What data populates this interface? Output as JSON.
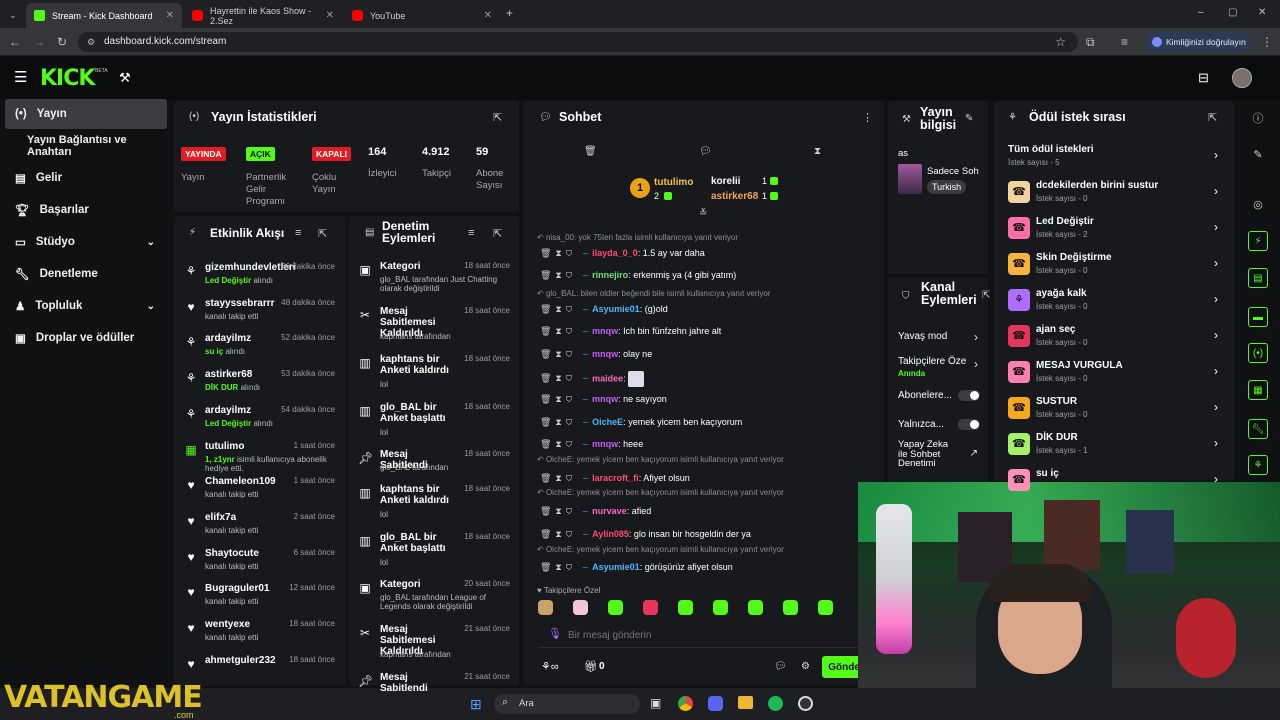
{
  "browser": {
    "tabs": [
      {
        "label": "Stream - Kick Dashboard",
        "active": true
      },
      {
        "label": "Hayrettin ile Kaos Show - 2.Sez",
        "active": false
      },
      {
        "label": "YouTube",
        "active": false
      }
    ],
    "url": "dashboard.kick.com/stream",
    "verify_label": "Kimliğinizi doğrulayın"
  },
  "kick": {
    "logo": "KICK",
    "beta": "BETA"
  },
  "sidebar": {
    "items": [
      {
        "label": "Yayın",
        "icon": "broadcast-icon"
      },
      {
        "label": "Yayın Bağlantısı ve Anahtarı"
      },
      {
        "label": "Gelir",
        "icon": "revenue-icon"
      },
      {
        "label": "Başarılar",
        "icon": "trophy-icon"
      },
      {
        "label": "Stüdyo",
        "icon": "studio-icon"
      },
      {
        "label": "Denetleme",
        "icon": "wrench-icon"
      },
      {
        "label": "Topluluk",
        "icon": "community-icon"
      },
      {
        "label": "Droplar ve ödüller",
        "icon": "gift-icon"
      }
    ]
  },
  "stats": {
    "title": "Yayın İstatistikleri",
    "live_badge": "YAYINDA",
    "live_label": "Yayın",
    "partner_badge": "AÇIK",
    "partner_label": "Partnerlik Gelir Programı",
    "multi_badge": "KAPALI",
    "multi_label": "Çoklu Yayın",
    "viewers": "164",
    "viewers_label": "İzleyici",
    "followers": "4.912",
    "followers_label": "Takipçi",
    "subs": "59",
    "subs_label": "Abone Sayısı"
  },
  "activity": {
    "title": "Etkinlik Akışı",
    "items": [
      {
        "name": "gizemhundevletleri",
        "time": "36 dakika önce",
        "sub": "Led Değiştir",
        "suffix": " alındı"
      },
      {
        "name": "stayyssebrarrr",
        "time": "48 dakika önce",
        "sub": "",
        "suffix": "kanalı takip etti"
      },
      {
        "name": "ardayilmz",
        "time": "52 dakika önce",
        "sub": "su iç",
        "suffix": " alındı"
      },
      {
        "name": "astirker68",
        "time": "53 dakika önce",
        "sub": "DİK DUR",
        "suffix": " alındı"
      },
      {
        "name": "ardayilmz",
        "time": "54 dakika önce",
        "sub": "Led Değiştir",
        "suffix": " alındı"
      },
      {
        "name": "tutulimo",
        "time": "1 saat önce",
        "sub": "1, z1ynr",
        "suffix": " isimli kullanıcıya abonelik hediye etti."
      },
      {
        "name": "Chameleon109",
        "time": "1 saat önce",
        "sub": "",
        "suffix": "kanalı takip etti"
      },
      {
        "name": "elifx7a",
        "time": "2 saat önce",
        "sub": "",
        "suffix": "kanalı takip etti"
      },
      {
        "name": "Shaytocute",
        "time": "6 saat önce",
        "sub": "",
        "suffix": "kanalı takip etti"
      },
      {
        "name": "Bugraguler01",
        "time": "12 saat önce",
        "sub": "",
        "suffix": "kanalı takip etti"
      },
      {
        "name": "wentyexe",
        "time": "18 saat önce",
        "sub": "",
        "suffix": "kanalı takip etti"
      },
      {
        "name": "ahmetguler232",
        "time": "18 saat önce",
        "sub": "",
        "suffix": ""
      }
    ]
  },
  "moderation": {
    "title": "Denetim Eylemleri",
    "items": [
      {
        "title": "Kategori",
        "time": "18 saat önce",
        "desc": "glo_BAL tarafından Just Chatting olarak değiştirildi"
      },
      {
        "title": "Mesaj Sabitlemesi Kaldırıldı",
        "time": "18 saat önce",
        "desc": "kaphtans tarafından"
      },
      {
        "title": "kaphtans bir Anketi kaldırdı",
        "time": "18 saat önce",
        "desc": "lol"
      },
      {
        "title": "glo_BAL bir Anket başlattı",
        "time": "18 saat önce",
        "desc": "lol"
      },
      {
        "title": "Mesaj Sabitlendi",
        "time": "18 saat önce",
        "desc": "glo_BAL tarafından"
      },
      {
        "title": "kaphtans bir Anketi kaldırdı",
        "time": "18 saat önce",
        "desc": "lol"
      },
      {
        "title": "glo_BAL bir Anket başlattı",
        "time": "18 saat önce",
        "desc": "lol"
      },
      {
        "title": "Kategori",
        "time": "20 saat önce",
        "desc": "glo_BAL tarafından League of Legends olarak değiştirildi"
      },
      {
        "title": "Mesaj Sabitlemesi Kaldırıldı",
        "time": "21 saat önce",
        "desc": "kaphtans tarafından"
      },
      {
        "title": "Mesaj Sabitlendi",
        "time": "21 saat önce",
        "desc": ""
      }
    ]
  },
  "chat": {
    "title": "Sohbet",
    "gifters": [
      {
        "name": "tutulimo",
        "count": "2"
      },
      {
        "name": "korelii",
        "count": "1"
      },
      {
        "name": "astirker68",
        "count": "1"
      }
    ],
    "rank": "1",
    "messages": [
      {
        "reply": "nisa_00: yok 75ten fazla isimli kullanıcıya yanıt veriyor",
        "user": "ilayda_0_0",
        "color": "#ff4d6d",
        "text": "1.5 ay var daha"
      },
      {
        "reply": "",
        "user": "rinnejiro",
        "color": "#6fe07d",
        "text": "erkenmiş ya (4 gibi yatım)"
      },
      {
        "reply": "glo_BAL: bilen oldler beğendi bile isimli kullanıcıya yanıt veriyor",
        "user": "Asyumie01",
        "color": "#4fb6ff",
        "text": "(g)old"
      },
      {
        "reply": "",
        "user": "mnqw",
        "color": "#c85cff",
        "text": "Ich bin fünfzehn jahre alt"
      },
      {
        "reply": "",
        "user": "mnqw",
        "color": "#c85cff",
        "text": "olay ne"
      },
      {
        "reply": "",
        "user": "maidee",
        "color": "#ff66c4",
        "text": ""
      },
      {
        "reply": "",
        "user": "mnqw",
        "color": "#c85cff",
        "text": "ne sayıyon"
      },
      {
        "reply": "",
        "user": "OicheE",
        "color": "#4fb6ff",
        "text": "yemek yicem ben kaçıyorum"
      },
      {
        "reply": "",
        "user": "mnqw",
        "color": "#c85cff",
        "text": "heee"
      },
      {
        "reply": "OicheE: yemek yicem ben kaçıyorum isimli kullanıcıya yanıt veriyor",
        "user": "laracroft_fi",
        "color": "#ff4d6d",
        "text": "Afiyet olsun"
      },
      {
        "reply": "OicheE: yemek yicem ben kaçıyorum isimli kullanıcıya yanıt veriyor",
        "user": "nurvave",
        "color": "#ff66c4",
        "text": "afied"
      },
      {
        "reply": "",
        "user": "Aylin085",
        "color": "#ff4d6d",
        "text": "glo insan bir hosgeldin der ya"
      },
      {
        "reply": "OicheE: yemek yicem ben kaçıyorum isimli kullanıcıya yanıt veriyor",
        "user": "Asyumie01",
        "color": "#4fb6ff",
        "text": "görüşürüz afiyet olsun"
      }
    ],
    "emote_label": "Takipçilere Özel",
    "placeholder": "Bir mesaj gönderin",
    "send": "Gönder",
    "drops_count": "0"
  },
  "stream_info": {
    "title": "Yayın bilgisi",
    "stream_title": "as",
    "category": "Sadece Soh",
    "tag": "Turkish"
  },
  "channel_actions": {
    "title": "Kanal Eylemleri",
    "slow": "Yavaş mod",
    "followers_only": "Takipçilere Öze",
    "followers_status": "Anında",
    "subs_only": "Abonelere...",
    "emotes_only": "Yalnızca...",
    "ai_mod": "Yapay Zeka ile Sohbet Denetimi"
  },
  "rewards": {
    "title": "Ödül istek sırası",
    "all_title": "Tüm ödül istekleri",
    "all_count": "İstek sayısı - 5",
    "items": [
      {
        "name": "dcdekilerden birini sustur",
        "count": "İstek sayısı - 0",
        "color": "#f4d39a"
      },
      {
        "name": "Led Değiştir",
        "count": "İstek sayısı - 2",
        "color": "#ff6ea8"
      },
      {
        "name": "Skin Değiştirme",
        "count": "İstek sayısı - 0",
        "color": "#f6b53a"
      },
      {
        "name": "ayağa kalk",
        "count": "İstek sayısı - 0",
        "color": "#b06cff"
      },
      {
        "name": "ajan seç",
        "count": "İstek sayısı - 0",
        "color": "#e8365a"
      },
      {
        "name": "MESAJ VURGULA",
        "count": "İstek sayısı - 0",
        "color": "#ff7fb0"
      },
      {
        "name": "SUSTUR",
        "count": "İstek sayısı - 0",
        "color": "#f6a71a"
      },
      {
        "name": "DİK DUR",
        "count": "İstek sayısı - 1",
        "color": "#a4f06a"
      },
      {
        "name": "su iç",
        "count": "",
        "color": "#ff8fb8"
      }
    ]
  },
  "taskbar": {
    "search": "Ara",
    "watermark": "VATANGAME",
    "watermark_sub": ".com"
  },
  "colors": {
    "accent": "#53fc18",
    "panel": "#17191c",
    "live_red": "#e31b23"
  }
}
